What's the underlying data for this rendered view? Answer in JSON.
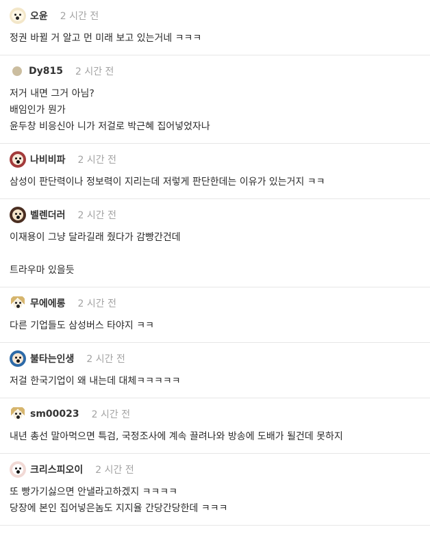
{
  "comments": [
    {
      "user": "오윤",
      "time": "2 시간 전",
      "avatar": "dog-face",
      "lines": [
        "정권 바뀔 거 알고 먼 미래 보고 있는거네 ㅋㅋㅋ"
      ]
    },
    {
      "user": "Dy815",
      "time": "2 시간 전",
      "avatar": "dot",
      "lines": [
        "저거 내면 그거 아님?",
        "배임인가 뭔가",
        "윤두창 비응신아 니가 저걸로 박근혜 집어넣었자나"
      ]
    },
    {
      "user": "나비비파",
      "time": "2 시간 전",
      "avatar": "red",
      "lines": [
        "삼성이 판단력이나 정보력이 지리는데 저렇게 판단한데는 이유가 있는거지 ㅋㅋ"
      ]
    },
    {
      "user": "벨렌더러",
      "time": "2 시간 전",
      "avatar": "dark",
      "lines": [
        "이재용이 그냥 달라길래 줬다가 감빵간건데",
        "",
        "트라우마 있을듯"
      ]
    },
    {
      "user": "무에에롱",
      "time": "2 시간 전",
      "avatar": "ears",
      "lines": [
        "다른 기업들도 삼성버스 타야지 ㅋㅋ"
      ]
    },
    {
      "user": "불타는인생",
      "time": "2 시간 전",
      "avatar": "blue",
      "lines": [
        "저걸 한국기업이 왜 내는데 대체ㅋㅋㅋㅋㅋ"
      ]
    },
    {
      "user": "sm00023",
      "time": "2 시간 전",
      "avatar": "ears",
      "lines": [
        "내년 총선 말아먹으면 특검, 국정조사에 계속 끌려나와 방송에 도배가 될건데 못하지"
      ]
    },
    {
      "user": "크리스피오이",
      "time": "2 시간 전",
      "avatar": "pink",
      "lines": [
        "또 빵가기싫으면 안낼라고하겠지 ㅋㅋㅋㅋ",
        "당장에 본인 집어넣은놈도 지지율 간당간당한데 ㅋㅋㅋ"
      ]
    }
  ]
}
